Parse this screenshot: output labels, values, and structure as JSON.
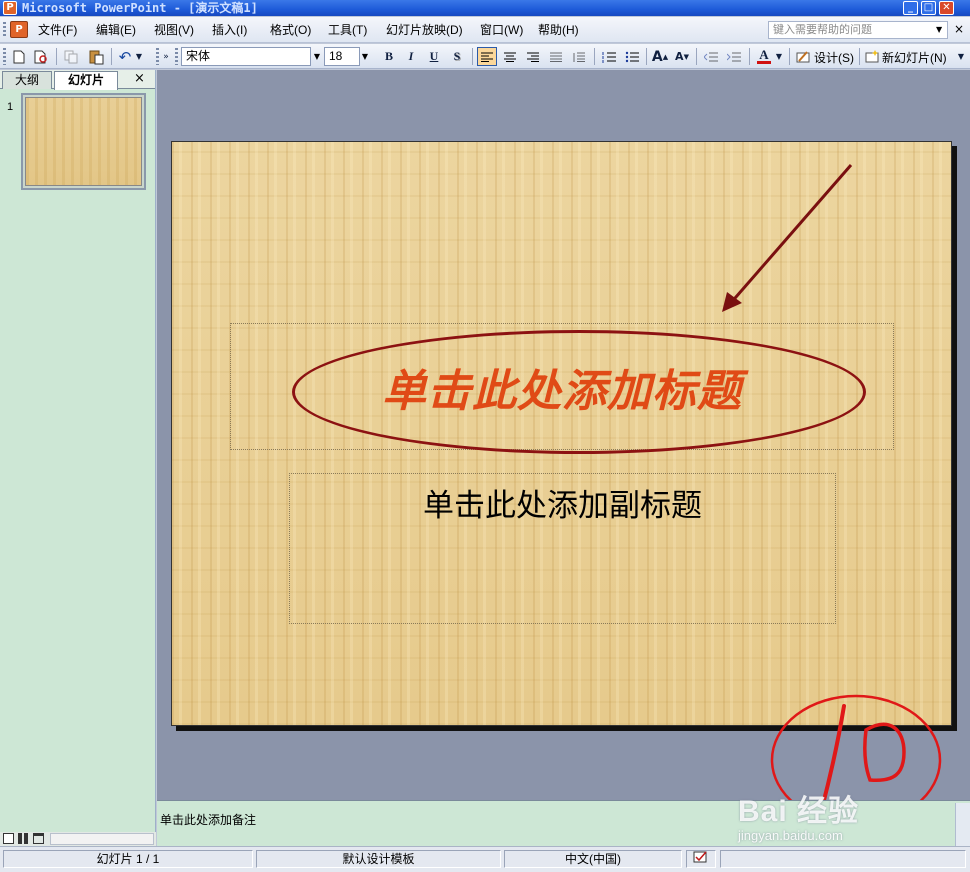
{
  "window": {
    "title": "Microsoft PowerPoint - [演示文稿1]",
    "buttons": {
      "minimize": "_",
      "maximize": "□",
      "close": "✕"
    }
  },
  "menubar": {
    "items": [
      {
        "label": "文件(F)"
      },
      {
        "label": "编辑(E)"
      },
      {
        "label": "视图(V)"
      },
      {
        "label": "插入(I)"
      },
      {
        "label": "格式(O)"
      },
      {
        "label": "工具(T)"
      },
      {
        "label": "幻灯片放映(D)"
      },
      {
        "label": "窗口(W)"
      },
      {
        "label": "帮助(H)"
      }
    ],
    "help_placeholder": "键入需要帮助的问题",
    "close_glyph": "×"
  },
  "toolbar": {
    "font_name": "宋体",
    "font_size": "18",
    "bold": "B",
    "italic": "I",
    "underline": "U",
    "shadow": "S",
    "design_label": "设计(S)",
    "new_slide_label": "新幻灯片(N)",
    "font_color": "#d01010",
    "active_alignment": "align-left"
  },
  "left_pane": {
    "tab_outline": "大纲",
    "tab_slides": "幻灯片",
    "close_glyph": "×",
    "slide_number": "1"
  },
  "slide": {
    "title_placeholder": "单击此处添加标题",
    "subtitle_placeholder": "单击此处添加副标题",
    "annotation_color": "#8c1212",
    "handwritten_mark": "10"
  },
  "notes": {
    "placeholder": "单击此处添加备注"
  },
  "statusbar": {
    "slide_position": "幻灯片 1 / 1",
    "design_template": "默认设计模板",
    "language": "中文(中国)"
  },
  "watermark": {
    "main": "Bai 经验",
    "url": "jingyan.baidu.com"
  }
}
